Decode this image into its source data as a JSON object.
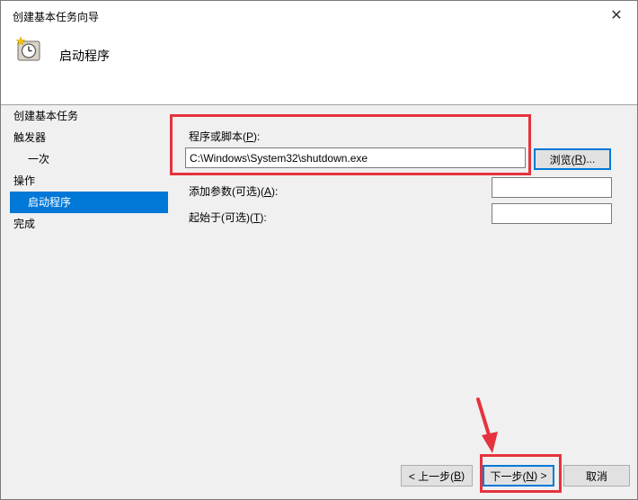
{
  "window": {
    "title": "创建基本任务向导",
    "close_glyph": "✕"
  },
  "header": {
    "title": "启动程序",
    "icon": "clock-icon"
  },
  "nav": {
    "items": [
      {
        "label": "创建基本任务"
      },
      {
        "label": "触发器"
      },
      {
        "label": "一次"
      },
      {
        "label": "操作"
      },
      {
        "label": "启动程序"
      },
      {
        "label": "完成"
      }
    ]
  },
  "form": {
    "program_label_pre": "程序或脚本(",
    "program_label_key": "P",
    "program_label_post": "):",
    "program_value": "C:\\Windows\\System32\\shutdown.exe",
    "browse_pre": "浏览(",
    "browse_key": "R",
    "browse_post": ")...",
    "args_label_pre": "添加参数(可选)(",
    "args_label_key": "A",
    "args_label_post": "):",
    "args_value": "",
    "start_label_pre": "起始于(可选)(",
    "start_label_key": "T",
    "start_label_post": "):",
    "start_value": ""
  },
  "buttons": {
    "back_pre": "< 上一步(",
    "back_key": "B",
    "back_post": ")",
    "next_pre": "下一步(",
    "next_key": "N",
    "next_post": ") >",
    "cancel": "取消"
  },
  "annotation": {
    "color": "#e5333d"
  },
  "colors": {
    "selection": "#0078d7"
  }
}
